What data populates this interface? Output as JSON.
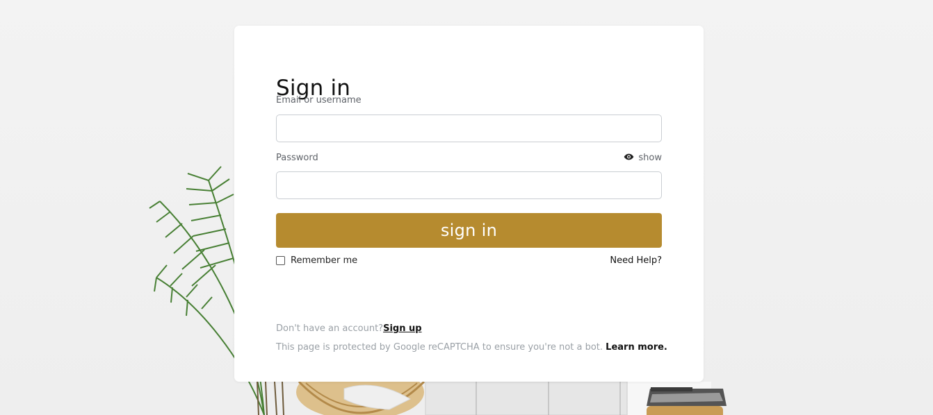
{
  "form": {
    "title": "Sign in",
    "email_label": "Email or username",
    "email_value": "",
    "password_label": "Password",
    "password_value": "",
    "show_label": "show",
    "submit_label": "sign in",
    "remember_label": "Remember me",
    "remember_checked": false,
    "help_label": "Need Help?"
  },
  "footer": {
    "no_account_text": "Don't have an account?",
    "signup_label": "Sign up",
    "recaptcha_text": "This page is protected by Google reCAPTCHA to ensure you're not a bot.",
    "learn_more_label": "Learn more."
  },
  "icons": {
    "show_password": "eye-icon"
  },
  "colors": {
    "accent": "#b68b2f",
    "background": "#f1f1f1",
    "card": "#ffffff"
  }
}
